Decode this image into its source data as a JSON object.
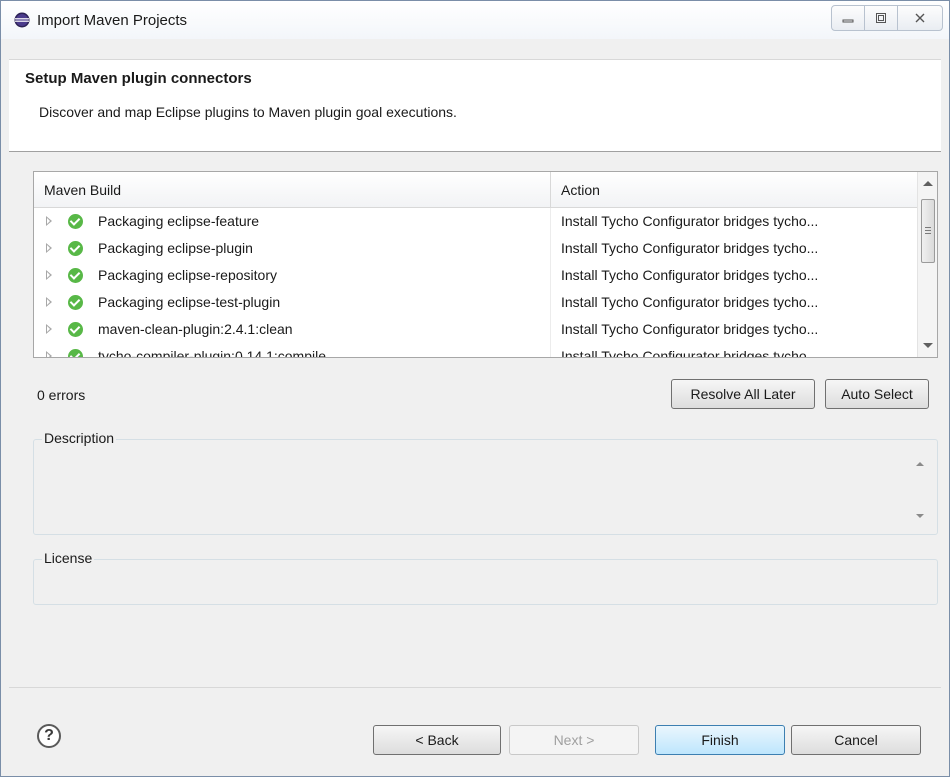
{
  "window": {
    "title": "Import Maven Projects",
    "icon": "eclipse-icon"
  },
  "caption": {
    "minimize": "minimize-icon",
    "restore": "restore-icon",
    "close": "close-icon"
  },
  "header": {
    "title": "Setup Maven plugin connectors",
    "subtitle": "Discover and map Eclipse plugins to Maven plugin goal executions."
  },
  "table": {
    "columns": [
      "Maven Build",
      "Action"
    ],
    "rows": [
      {
        "label": "Packaging eclipse-feature",
        "action": "Install Tycho Configurator bridges tycho..."
      },
      {
        "label": "Packaging eclipse-plugin",
        "action": "Install Tycho Configurator bridges tycho..."
      },
      {
        "label": "Packaging eclipse-repository",
        "action": "Install Tycho Configurator bridges tycho..."
      },
      {
        "label": "Packaging eclipse-test-plugin",
        "action": "Install Tycho Configurator bridges tycho..."
      },
      {
        "label": "maven-clean-plugin:2.4.1:clean",
        "action": "Install Tycho Configurator bridges tycho..."
      },
      {
        "label": "tycho-compiler-plugin:0.14.1:compile",
        "action": "Install Tycho Configurator bridges tycho..."
      }
    ],
    "status_color": "#58b847"
  },
  "status": {
    "errors": "0 errors"
  },
  "actions": {
    "resolve_all_later": "Resolve All Later",
    "auto_select": "Auto Select"
  },
  "groups": {
    "description": "Description",
    "license": "License"
  },
  "footer": {
    "help": "?",
    "back": "< Back",
    "next": "Next >",
    "finish": "Finish",
    "cancel": "Cancel"
  }
}
